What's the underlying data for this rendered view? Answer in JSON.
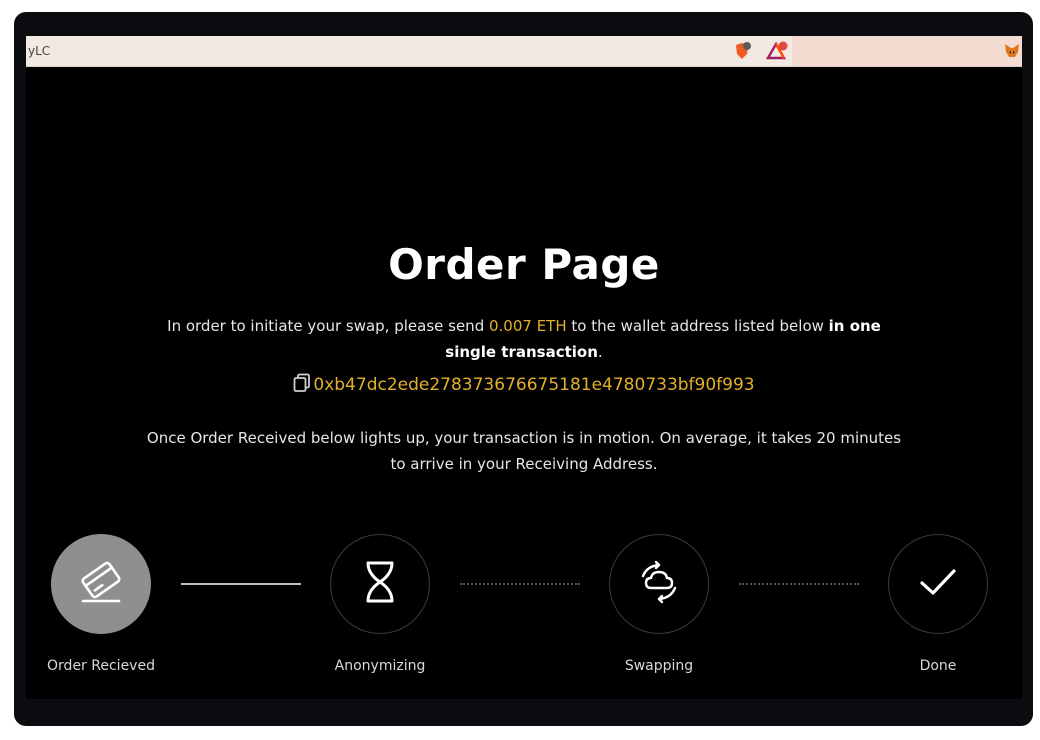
{
  "browser": {
    "url_fragment": "yLC",
    "extensions": [
      "brave-shield-icon",
      "bat-rewards-icon",
      "metamask-fox-icon"
    ]
  },
  "page": {
    "title": "Order Page",
    "intro_before": "In order to initiate your swap, please send ",
    "amount": "0.007 ETH",
    "intro_middle": " to the wallet address listed below ",
    "intro_bold": "in one single transaction",
    "intro_end": ".",
    "wallet_address": "0xb47dc2ede278373676675181e4780733bf90f993",
    "notice": "Once Order Received below lights up, your transaction is in motion. On average, it takes 20 minutes to arrive in your Receiving Address."
  },
  "steps": [
    {
      "label": "Order Recieved",
      "icon": "card-received-icon",
      "active": true
    },
    {
      "label": "Anonymizing",
      "icon": "hourglass-icon",
      "active": false
    },
    {
      "label": "Swapping",
      "icon": "cloud-sync-icon",
      "active": false
    },
    {
      "label": "Done",
      "icon": "checkmark-icon",
      "active": false
    }
  ],
  "colors": {
    "accent": "#e2b02a",
    "background": "#000000",
    "active_step": "#8f8f8f"
  }
}
